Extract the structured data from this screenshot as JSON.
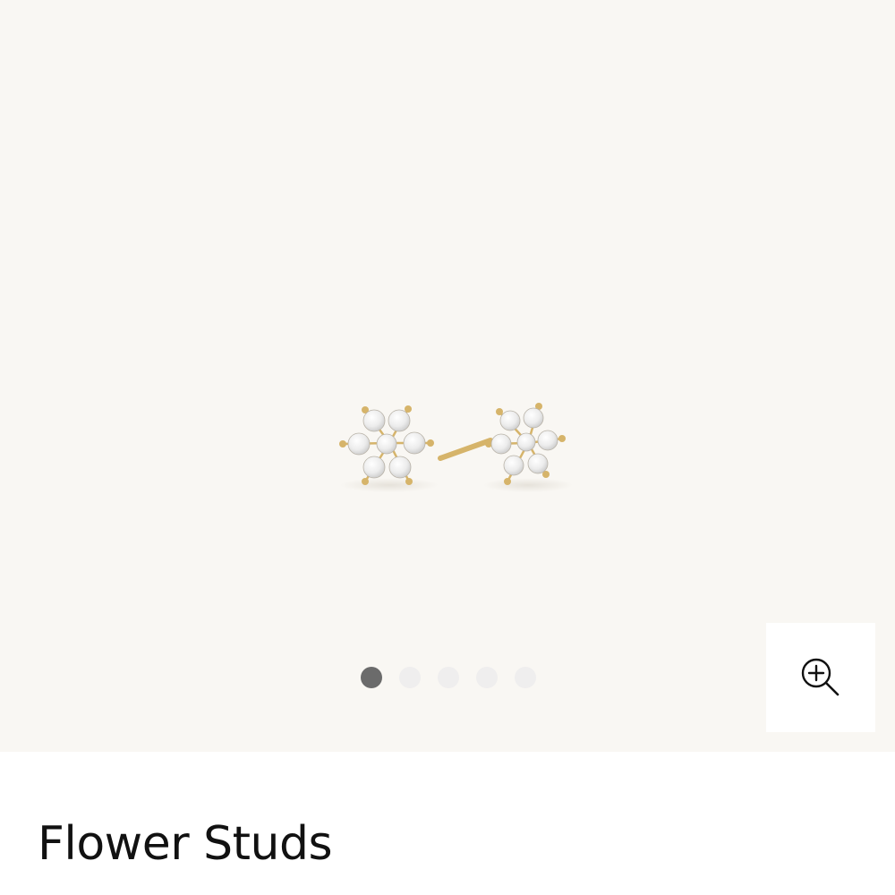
{
  "product": {
    "title": "Flower Studs"
  },
  "gallery": {
    "image_icon": "flower-stud-earrings",
    "dot_count": 5,
    "active_index": 0,
    "zoom_icon": "zoom-in-icon"
  },
  "colors": {
    "gallery_background": "#f9f7f3",
    "dot_active": "#6b6b6b",
    "dot_inactive": "#efeeee",
    "gold": "#d6b46a",
    "title_text": "#111111"
  }
}
